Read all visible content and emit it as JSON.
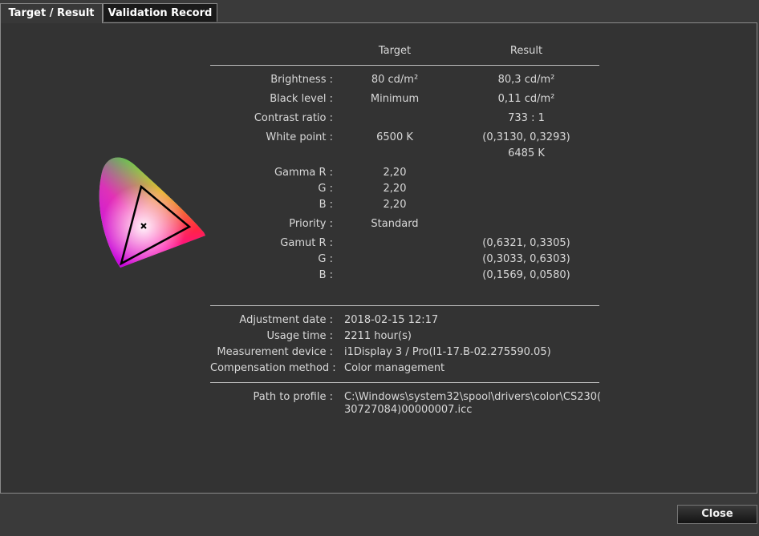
{
  "tabs": {
    "target_result": "Target / Result",
    "validation_record": "Validation Record"
  },
  "header": {
    "target": "Target",
    "result": "Result"
  },
  "rows": {
    "brightness": {
      "label": "Brightness :",
      "target": "80 cd/m²",
      "result": "80,3 cd/m²"
    },
    "black_level": {
      "label": "Black level :",
      "target": "Minimum",
      "result": "0,11 cd/m²"
    },
    "contrast": {
      "label": "Contrast ratio :",
      "result": "733 : 1"
    },
    "white_point": {
      "label": "White point :",
      "target": "6500 K",
      "result_xy": "(0,3130, 0,3293)",
      "result_k": "6485 K"
    },
    "gamma": {
      "label_r": "Gamma R :",
      "label_g": "G :",
      "label_b": "B :",
      "r": "2,20",
      "g": "2,20",
      "b": "2,20"
    },
    "priority": {
      "label": "Priority :",
      "target": "Standard"
    },
    "gamut": {
      "label_r": "Gamut R :",
      "label_g": "G :",
      "label_b": "B :",
      "r": "(0,6321, 0,3305)",
      "g": "(0,3033, 0,6303)",
      "b": "(0,1569, 0,0580)"
    }
  },
  "info": {
    "adjustment_date": {
      "label": "Adjustment date :",
      "value": "2018-02-15 12:17"
    },
    "usage_time": {
      "label": "Usage time :",
      "value": "2211 hour(s)"
    },
    "device": {
      "label": "Measurement device :",
      "value": "i1Display 3 / Pro(I1-17.B-02.275590.05)"
    },
    "compensation": {
      "label": "Compensation method :",
      "value": "Color management"
    },
    "path": {
      "label": "Path to profile :",
      "line1": "C:\\Windows\\system32\\spool\\drivers\\color\\CS230(",
      "line2": "30727084)00000007.icc"
    }
  },
  "buttons": {
    "close": "Close"
  },
  "colors": {
    "background": "#3a3a3a",
    "panel": "#333333",
    "text": "#d8d8d8",
    "rule": "#bdbdbd"
  }
}
